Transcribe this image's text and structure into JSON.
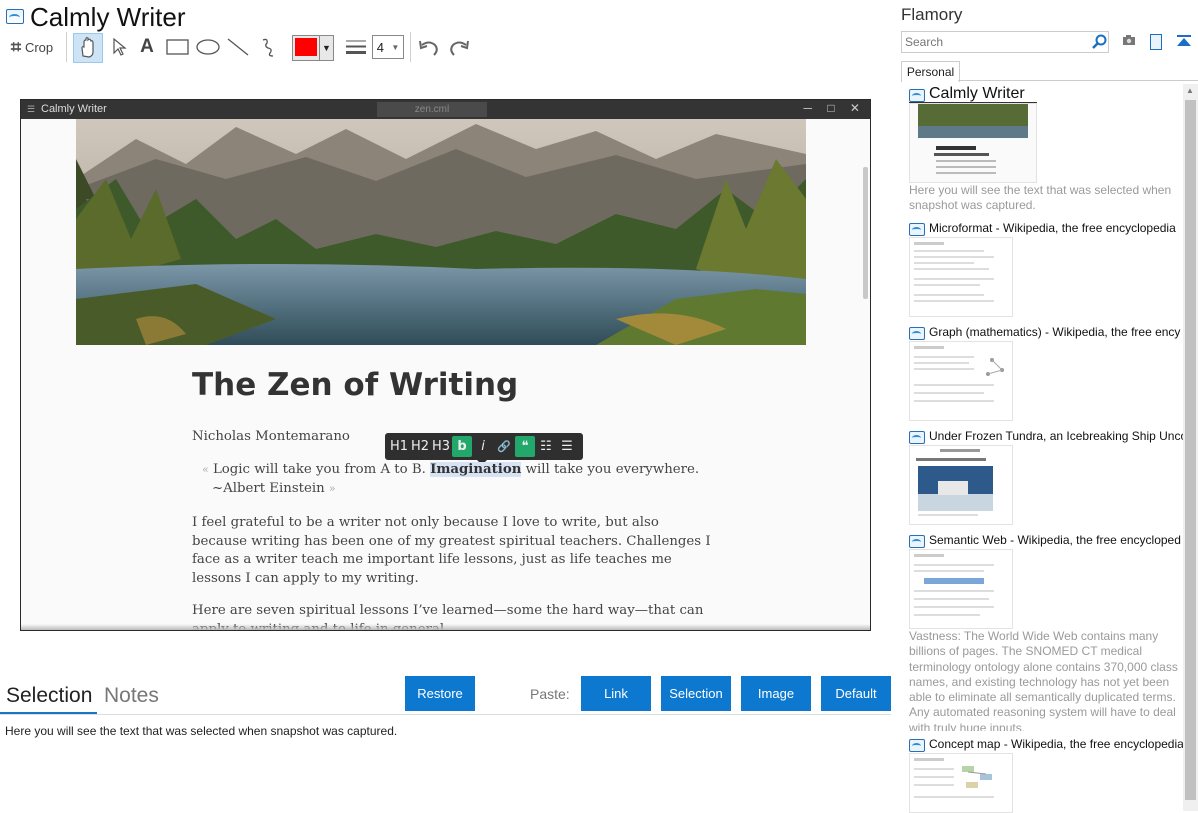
{
  "app": {
    "title": "Calmly Writer"
  },
  "toolbar": {
    "crop_label": "Crop",
    "color": "#ff0000",
    "line_width": "4"
  },
  "window": {
    "title": "Calmly Writer",
    "file": "zen.cml",
    "controls": "─ □ ✕"
  },
  "document": {
    "title": "The Zen of Writing",
    "author": "Nicholas Montemarano",
    "format_buttons": [
      "H1",
      "H2",
      "H3",
      "b",
      "i",
      "🔗",
      "❝",
      "☷",
      "☰"
    ],
    "quote_open": "«",
    "quote_before": " Logic will take you from A to B. ",
    "quote_highlight": "Imagination",
    "quote_after": " will take you everywhere.",
    "quote_attrib": "~Albert Einstein ",
    "quote_close": "»",
    "para1": "I feel grateful to be a writer not only because I love to write, but also because writing has been one of my greatest spiritual teachers. Challenges I face as a writer teach me important life lessons, just as life teaches me lessons I can apply to my writing.",
    "para2": "Here are seven spiritual lessons I’ve learned—some the hard way—that can apply to writing and to life in general."
  },
  "bottom": {
    "tab_selection": "Selection",
    "tab_notes": "Notes",
    "restore": "Restore",
    "paste_label": "Paste:",
    "link": "Link",
    "selection": "Selection",
    "image": "Image",
    "default": "Default",
    "selection_text": "Here you will see the text that was selected when snapshot was captured."
  },
  "panel": {
    "title": "Flamory",
    "search_placeholder": "Search",
    "tab": "Personal",
    "entries": [
      {
        "title": "Calmly Writer",
        "desc": "Here you will see the text that was selected when snapshot was captured."
      },
      {
        "title": "Microformat - Wikipedia, the free encyclopedia"
      },
      {
        "title": "Graph (mathematics) - Wikipedia, the free ency"
      },
      {
        "title": "Under Frozen Tundra, an Icebreaking Ship Unco"
      },
      {
        "title": "Semantic Web - Wikipedia, the free encycloped",
        "desc": "Vastness: The World Wide Web contains many billions of pages. The SNOMED CT medical terminology ontology alone contains 370,000 class names, and existing technology has not yet been able to eliminate all semantically duplicated terms. Any automated reasoning system will have to deal with truly huge inputs."
      },
      {
        "title": "Concept map - Wikipedia, the free encyclopedia"
      }
    ]
  }
}
